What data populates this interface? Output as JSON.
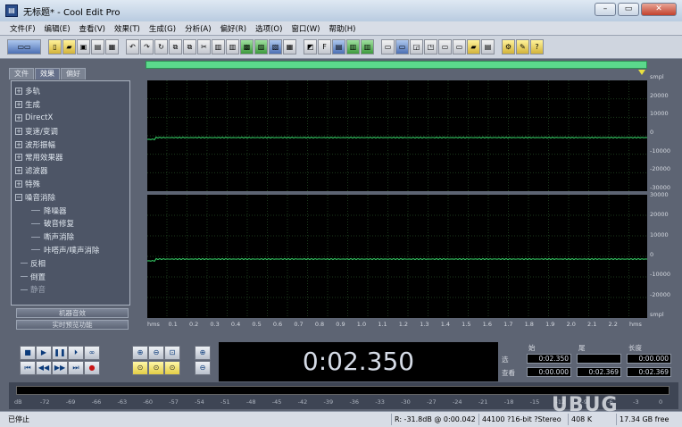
{
  "window": {
    "title": "无标题* - Cool Edit Pro",
    "controls": [
      "–",
      "▭",
      "✕"
    ]
  },
  "menu": [
    "文件(F)",
    "编辑(E)",
    "查看(V)",
    "效果(T)",
    "生成(G)",
    "分析(A)",
    "偏好(R)",
    "选项(O)",
    "窗口(W)",
    "帮助(H)"
  ],
  "panel": {
    "tabs": [
      "文件",
      "效果",
      "偏好"
    ],
    "tree": [
      {
        "label": "多轨",
        "type": "root",
        "box": "+"
      },
      {
        "label": "生成",
        "type": "root",
        "box": "+"
      },
      {
        "label": "DirectX",
        "type": "root",
        "box": "+"
      },
      {
        "label": "变速/变调",
        "type": "root",
        "box": "+"
      },
      {
        "label": "波形振幅",
        "type": "root",
        "box": "+"
      },
      {
        "label": "常用效果器",
        "type": "root",
        "box": "+"
      },
      {
        "label": "滤波器",
        "type": "root",
        "box": "+"
      },
      {
        "label": "特殊",
        "type": "root",
        "box": "+"
      },
      {
        "label": "噪音消除",
        "type": "root",
        "box": "−"
      },
      {
        "label": "降噪器",
        "type": "child"
      },
      {
        "label": "破音修复",
        "type": "child"
      },
      {
        "label": "嘶声消除",
        "type": "child"
      },
      {
        "label": "咔嗒声/噗声消除",
        "type": "child"
      },
      {
        "label": "反相",
        "type": "leaf"
      },
      {
        "label": "倒置",
        "type": "leaf"
      },
      {
        "label": "静音",
        "type": "leaf",
        "dim": true
      }
    ],
    "buttons": [
      "机器音效",
      "实时预览功能"
    ]
  },
  "wave": {
    "amp_top": [
      "smpl",
      "20000",
      "10000",
      "0",
      "-10000",
      "-20000",
      "-30000"
    ],
    "amp_bottom": [
      "30000",
      "20000",
      "10000",
      "0",
      "-10000",
      "-20000",
      "smpl"
    ],
    "time_ticks": [
      "hms",
      "0.1",
      "0.2",
      "0.3",
      "0.4",
      "0.5",
      "0.6",
      "0.7",
      "0.8",
      "0.9",
      "1.0",
      "1.1",
      "1.2",
      "1.3",
      "1.4",
      "1.5",
      "1.6",
      "1.7",
      "1.8",
      "1.9",
      "2.0",
      "2.1",
      "2.2",
      "hms"
    ]
  },
  "time_display": "0:02.350",
  "selection": {
    "headers": [
      "始",
      "尾",
      "长度"
    ],
    "rows": [
      {
        "label": "选",
        "begin": "0:02.350",
        "end": "",
        "length": "0:00.000"
      },
      {
        "label": "查看",
        "begin": "0:00.000",
        "end": "0:02.369",
        "length": "0:02.369"
      }
    ]
  },
  "meter_ticks": [
    "dB",
    "-72",
    "-69",
    "-66",
    "-63",
    "-60",
    "-57",
    "-54",
    "-51",
    "-48",
    "-45",
    "-42",
    "-39",
    "-36",
    "-33",
    "-30",
    "-27",
    "-24",
    "-21",
    "-18",
    "-15",
    "-12",
    "-9",
    "-6",
    "-3",
    "0"
  ],
  "status": {
    "state": "已停止",
    "cursor": "R: -31.8dB @  0:00.042",
    "format": "44100 ?16-bit ?Stereo",
    "size": "408 K",
    "free": "17.34 GB free"
  },
  "watermark": "UBUG"
}
